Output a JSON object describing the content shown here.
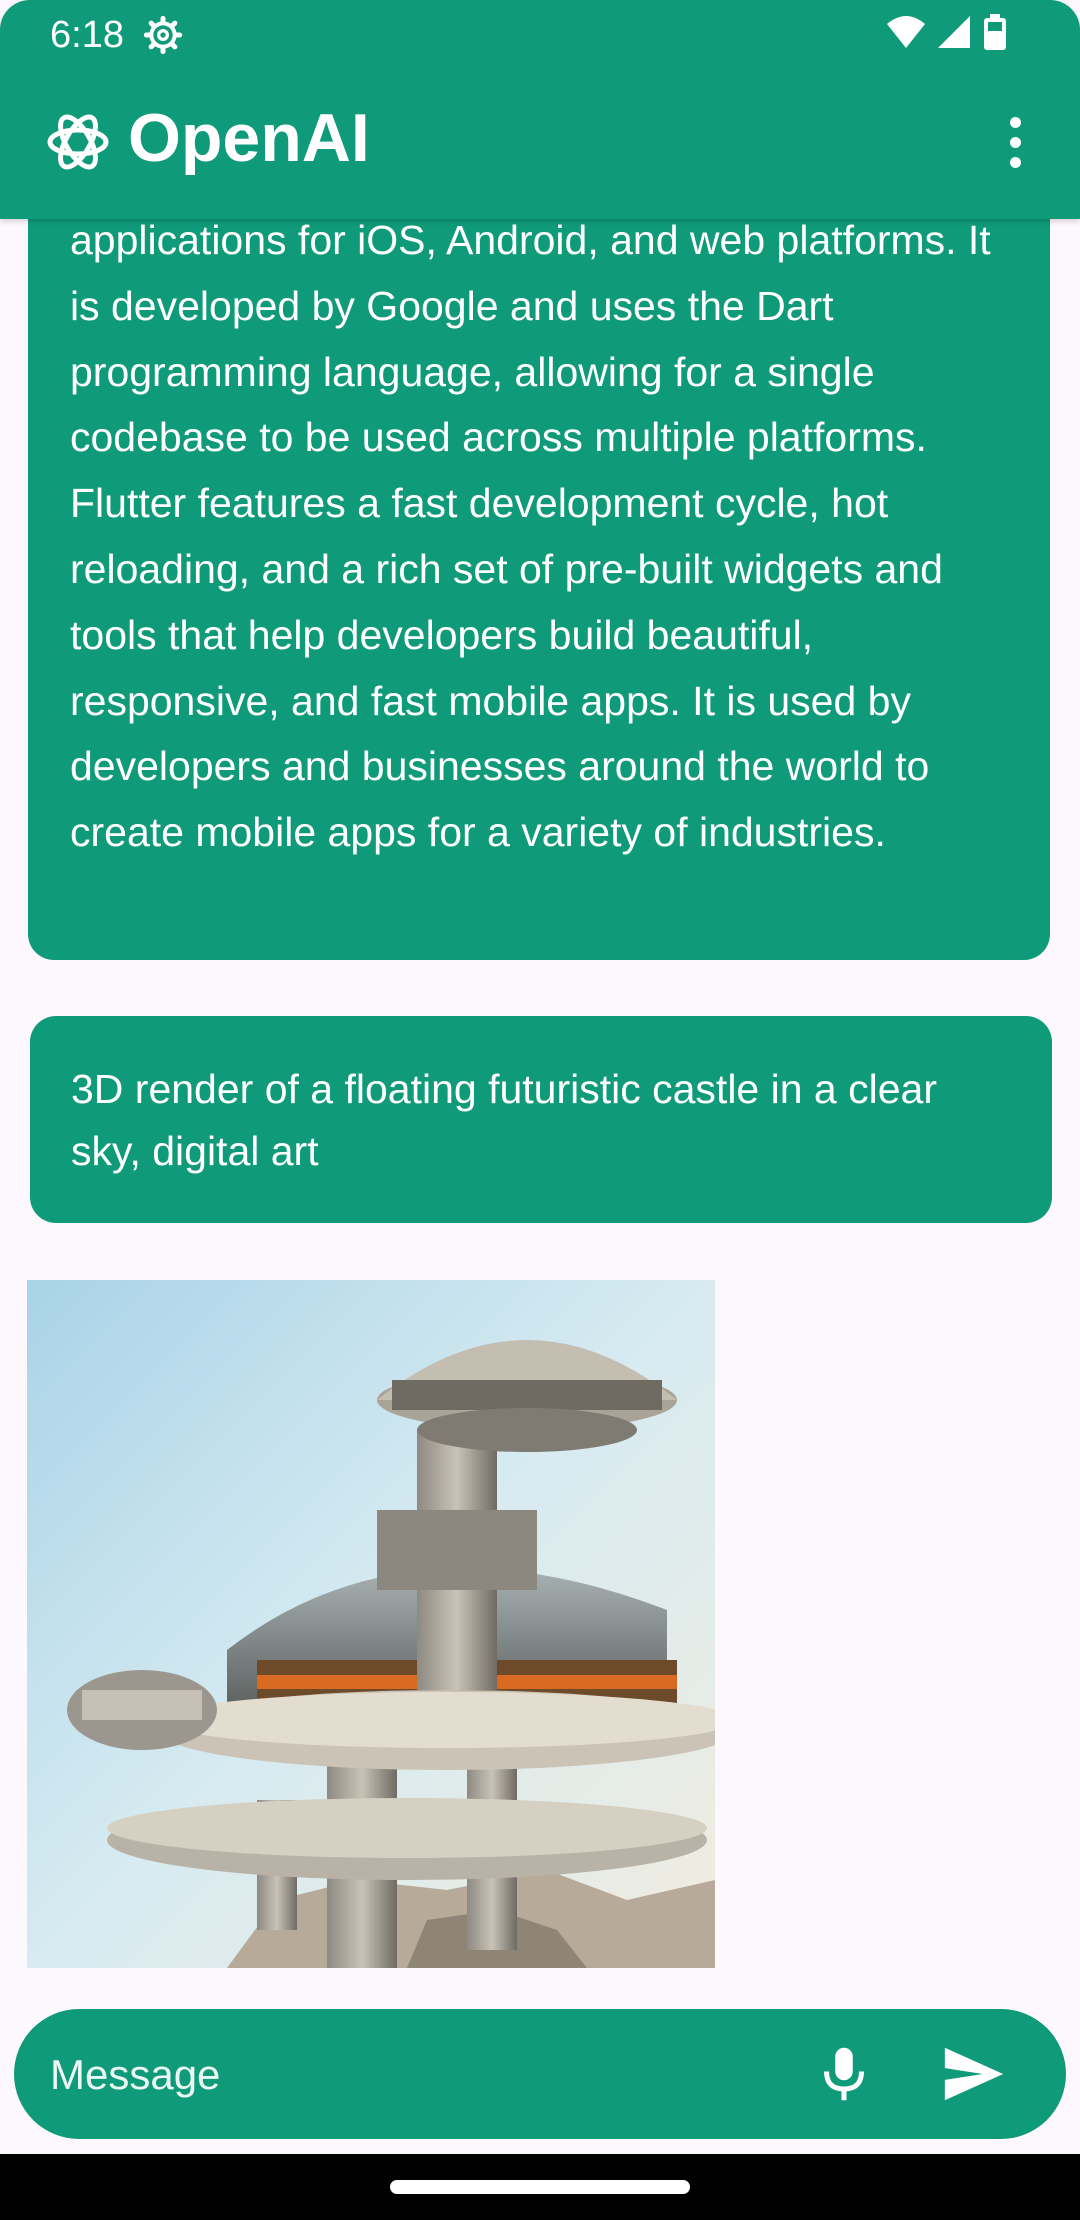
{
  "status_bar": {
    "time": "6:18",
    "icons": [
      "settings-gear-icon",
      "wifi-icon",
      "cell-signal-icon",
      "battery-icon"
    ]
  },
  "app_bar": {
    "title": "OpenAI",
    "logo_icon": "openai-logo-icon",
    "menu_icon": "more-vert-icon"
  },
  "colors": {
    "accent": "#0f9a79",
    "background": "#fdf8fd",
    "text_on_accent": "#ffffff",
    "nav_bar": "#000000"
  },
  "messages": [
    {
      "role": "assistant",
      "text": "applications for iOS, Android, and web platforms. It is developed by Google and uses the Dart programming language, allowing for a single codebase to be used across multiple platforms. Flutter features a fast development cycle, hot reloading, and a rich set of pre-built widgets and tools that help developers build beautiful, responsive, and fast mobile apps. It is used by developers and businesses around the world to create mobile apps for a variety of industries."
    },
    {
      "role": "user",
      "text": "3D render of a floating futuristic castle in a clear sky, digital art"
    },
    {
      "role": "assistant",
      "type": "image"
    }
  ],
  "composer": {
    "placeholder": "Message",
    "value": "",
    "mic_icon": "microphone-icon",
    "send_icon": "send-icon"
  }
}
